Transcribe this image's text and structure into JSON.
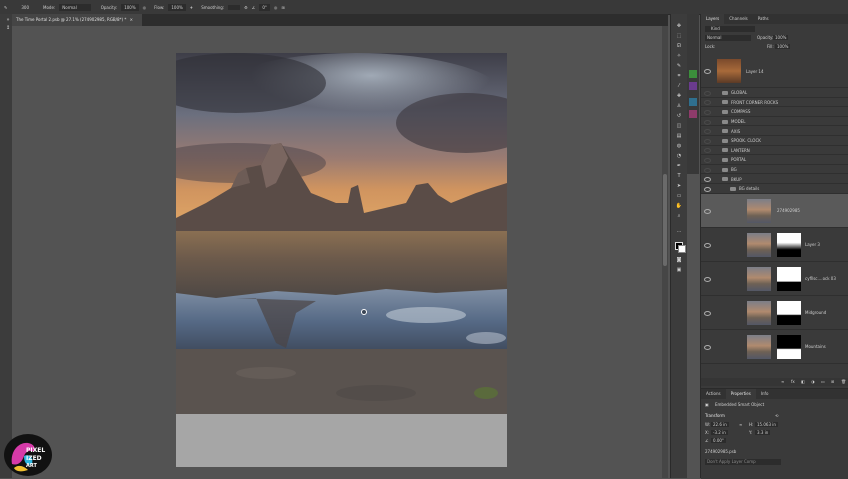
{
  "options_bar": {
    "mode_label": "Mode:",
    "mode_value": "Normal",
    "opacity_label": "Opacity:",
    "opacity_value": "100%",
    "flow_label": "Flow:",
    "flow_value": "100%",
    "smoothing_label": "Smoothing:",
    "angle_value": "0°",
    "brush_size": "300"
  },
  "document_tab": {
    "title": "The Time Portal 2.psb @ 27.1% (274902985, RGB/8*) *"
  },
  "layers_panel": {
    "tabs": [
      "Layers",
      "Channels",
      "Paths"
    ],
    "filter_kind": "Kind",
    "blend_mode": "Normal",
    "opacity_label": "Opacity:",
    "opacity_value": "100%",
    "lock_label": "Lock:",
    "fill_label": "Fill:",
    "fill_value": "100%",
    "layers": [
      {
        "name": "Layer 14",
        "type": "image"
      },
      {
        "name": "GLOBAL",
        "type": "folder"
      },
      {
        "name": "FRONT CORNER ROCKS",
        "type": "folder"
      },
      {
        "name": "COMPASS",
        "type": "folder"
      },
      {
        "name": "MODEL",
        "type": "folder"
      },
      {
        "name": "AXIS",
        "type": "folder"
      },
      {
        "name": "SPOOK. CLOCK",
        "type": "folder"
      },
      {
        "name": "LANTERN",
        "type": "folder"
      },
      {
        "name": "PORTAL",
        "type": "folder"
      },
      {
        "name": "BG",
        "type": "folder"
      },
      {
        "name": "BKUP",
        "type": "folder"
      },
      {
        "name": "BG details",
        "type": "folder"
      },
      {
        "name": "274902985",
        "type": "smart"
      },
      {
        "name": "Layer 3",
        "type": "masked"
      },
      {
        "name": "cyfllsc....ock 03",
        "type": "masked"
      },
      {
        "name": "Midground",
        "type": "masked"
      },
      {
        "name": "Mountains",
        "type": "masked"
      }
    ]
  },
  "properties_panel": {
    "tabs": [
      "Actions",
      "Properties",
      "Info"
    ],
    "object_type": "Embedded Smart Object",
    "section": "Transform",
    "w_label": "W:",
    "w_value": "22.6 in",
    "h_label": "H:",
    "h_value": "15.063 in",
    "x_label": "X:",
    "x_value": "-3.2 in",
    "y_label": "Y:",
    "y_value": "3.3 in",
    "angle_value": "0.00°",
    "filename": "274902985.psb",
    "layer_comp": "Don't Apply Layer Comp"
  },
  "watermark": {
    "line1": "PIXEL",
    "line2": "IZED",
    "line3": "ART"
  },
  "colors": {
    "app_bg": "#535353",
    "panel_bg": "#3a3a3a",
    "selected_layer": "#5a5a5a"
  }
}
